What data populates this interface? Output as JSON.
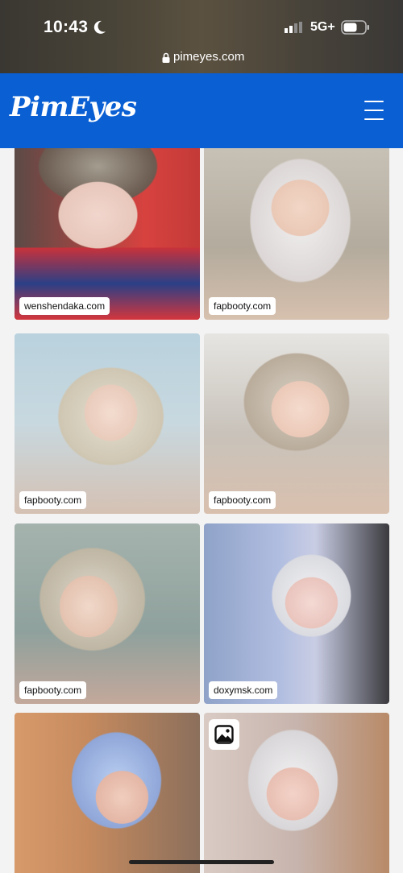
{
  "status_bar": {
    "time": "10:43",
    "network": "5G+"
  },
  "browser": {
    "url": "pimeyes.com"
  },
  "header": {
    "logo": "PimEyes",
    "brand_color": "#0a5fd3"
  },
  "results": [
    {
      "source": "wenshendaka.com"
    },
    {
      "source": "fapbooty.com"
    },
    {
      "source": "fapbooty.com"
    },
    {
      "source": "fapbooty.com"
    },
    {
      "source": "fapbooty.com"
    },
    {
      "source": "doxymsk.com"
    },
    {
      "source": ""
    },
    {
      "source": "",
      "badge_icon": "image-icon"
    }
  ]
}
